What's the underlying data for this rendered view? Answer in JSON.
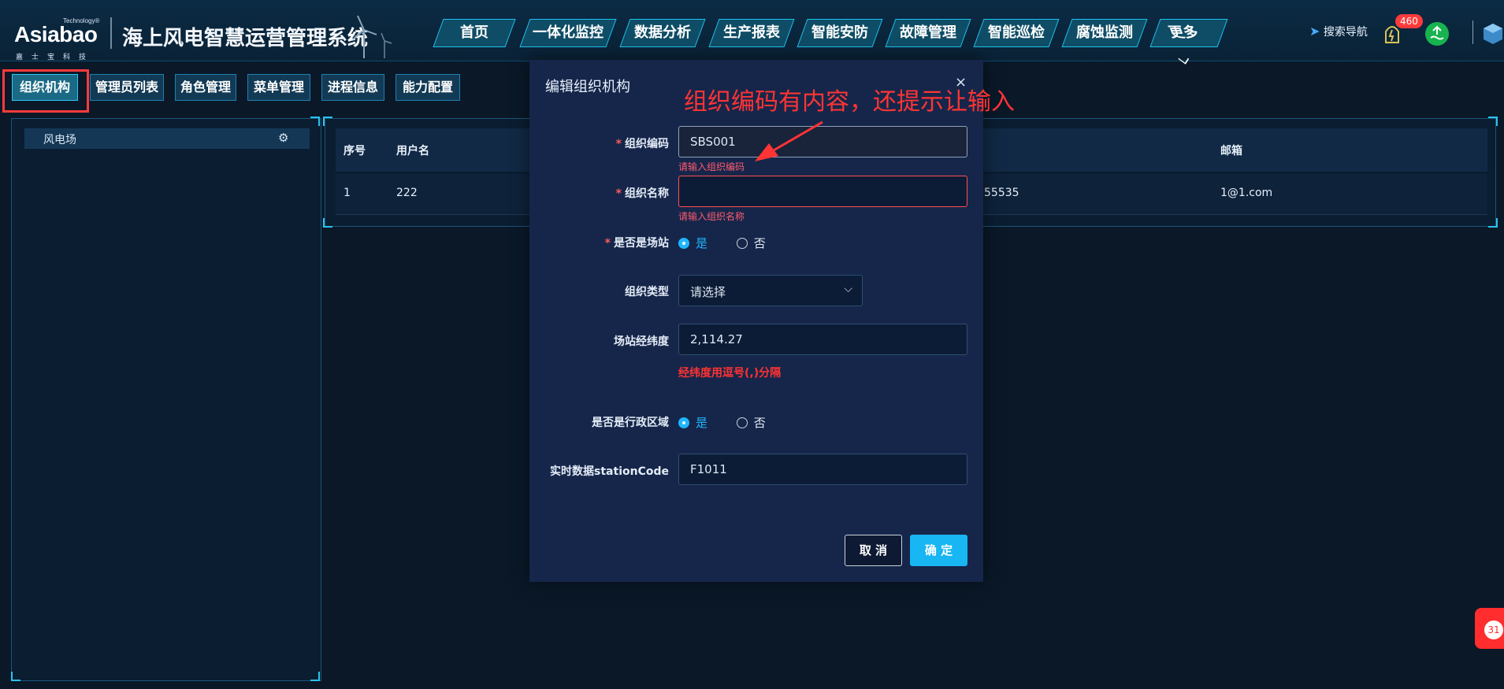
{
  "header": {
    "logo_text": "Asiabao",
    "logo_tech": "Technology®",
    "logo_cn": "嘉士宝科技",
    "app_title": "海上风电智慧运营管理系统",
    "nav": [
      "首页",
      "一体化监控",
      "数据分析",
      "生产报表",
      "智能安防",
      "故障管理",
      "智能巡检",
      "腐蚀监测",
      "更多"
    ],
    "search_nav": "搜索导航",
    "notification_count": "460"
  },
  "subtabs": [
    "组织机构",
    "管理员列表",
    "角色管理",
    "菜单管理",
    "进程信息",
    "能力配置"
  ],
  "tree": {
    "root_label": "风电场"
  },
  "table": {
    "headers": {
      "index": "序号",
      "username": "用户名",
      "email": "邮箱"
    },
    "row": {
      "index": "1",
      "username": "222",
      "phone_partial": "55535",
      "email": "1@1.com"
    }
  },
  "modal": {
    "title": "编辑组织机构",
    "close": "×",
    "fields": {
      "org_code_label": "组织编码",
      "org_code_value": "SBS001",
      "org_code_error": "请输入组织编码",
      "org_name_label": "组织名称",
      "org_name_value": "",
      "org_name_error": "请输入组织名称",
      "is_station_label": "是否是场站",
      "org_type_label": "组织类型",
      "org_type_value": "请选择",
      "coords_label": "场站经纬度",
      "coords_value": "2,114.27",
      "coords_hint": "经纬度用逗号(,)分隔",
      "is_admin_area_label": "是否是行政区域",
      "station_code_label": "实时数据stationCode",
      "station_code_value": "F1011"
    },
    "radio_yes": "是",
    "radio_no": "否",
    "cancel": "取 消",
    "confirm": "确 定"
  },
  "annotation": "组织编码有内容，还提示让输入",
  "float_badge": "31"
}
